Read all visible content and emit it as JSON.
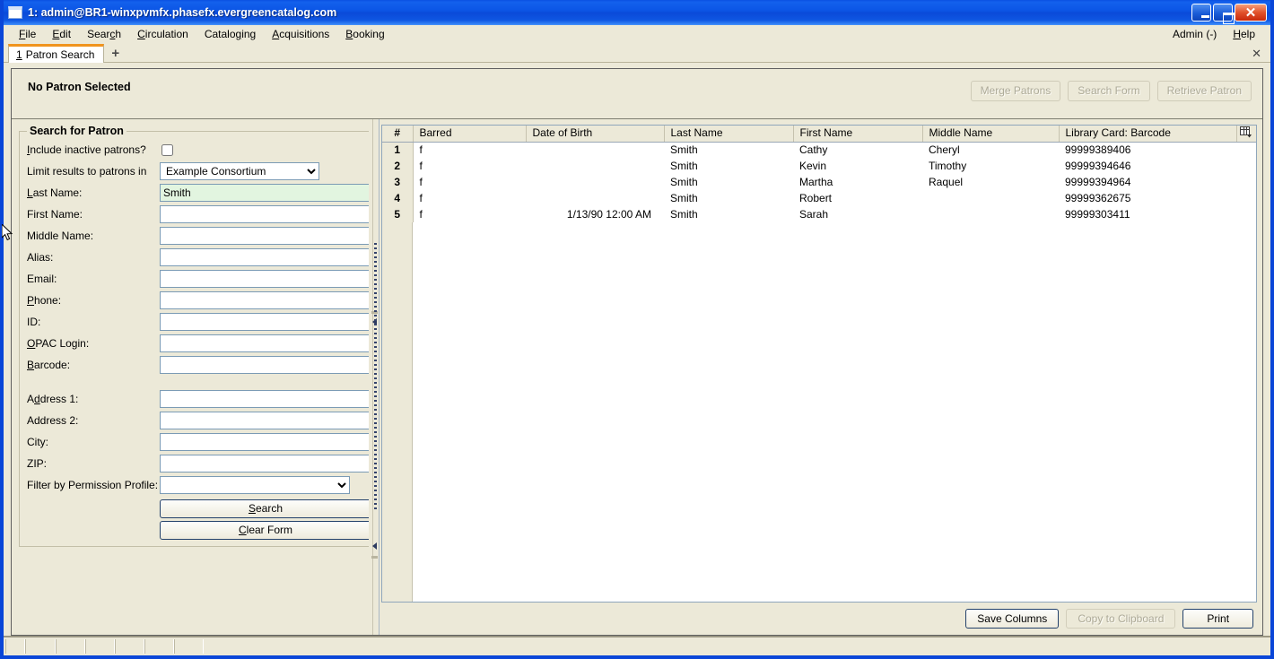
{
  "window": {
    "title": "1: admin@BR1-winxpvmfx.phasefx.evergreencatalog.com",
    "minimize_label": "",
    "maximize_label": "",
    "close_label": "✕"
  },
  "menubar": {
    "items": [
      {
        "label": "File",
        "mnemonic": "F"
      },
      {
        "label": "Edit",
        "mnemonic": "E"
      },
      {
        "label": "Search",
        "mnemonic": "c"
      },
      {
        "label": "Circulation",
        "mnemonic": "C"
      },
      {
        "label": "Cataloging",
        "mnemonic": "g"
      },
      {
        "label": "Acquisitions",
        "mnemonic": "A"
      },
      {
        "label": "Booking",
        "mnemonic": "B"
      }
    ],
    "right_items": [
      {
        "label": "Admin (-)"
      },
      {
        "label": "Help",
        "mnemonic": "H"
      }
    ]
  },
  "tabstrip": {
    "tabs": [
      {
        "number": "1",
        "label": "Patron Search"
      }
    ],
    "new_tab_label": "+",
    "close_label": "✕"
  },
  "patron_bar": {
    "status": "No Patron Selected",
    "actions": [
      {
        "label": "Merge Patrons",
        "disabled": true
      },
      {
        "label": "Search Form",
        "disabled": true
      },
      {
        "label": "Retrieve Patron",
        "disabled": true
      }
    ]
  },
  "search_form": {
    "legend": "Search for Patron",
    "include_inactive_label": "Include inactive patrons?",
    "include_inactive_checked": false,
    "limit_label": "Limit results to patrons in",
    "limit_value": "Example Consortium",
    "limit_options": [
      "Example Consortium"
    ],
    "fields": [
      {
        "label": "Last Name:",
        "value": "Smith",
        "focused": true
      },
      {
        "label": "First Name:",
        "value": ""
      },
      {
        "label": "Middle Name:",
        "value": ""
      },
      {
        "label": "Alias:",
        "value": ""
      },
      {
        "label": "Email:",
        "value": ""
      },
      {
        "label": "Phone:",
        "value": ""
      },
      {
        "label": "ID:",
        "value": ""
      },
      {
        "label": "OPAC Login:",
        "value": ""
      },
      {
        "label": "Barcode:",
        "value": ""
      }
    ],
    "address_fields": [
      {
        "label": "Address 1:",
        "value": ""
      },
      {
        "label": "Address 2:",
        "value": ""
      },
      {
        "label": "City:",
        "value": ""
      },
      {
        "label": "ZIP:",
        "value": ""
      }
    ],
    "permission_label": "Filter by Permission Profile:",
    "permission_value": "",
    "permission_options": [
      ""
    ],
    "search_button": "Search",
    "clear_button": "Clear Form"
  },
  "results": {
    "columns": [
      "#",
      "Barred",
      "Date of Birth",
      "Last Name",
      "First Name",
      "Middle Name",
      "Library Card: Barcode"
    ],
    "column_picker_icon": "column-picker-icon",
    "rows": [
      {
        "num": "1",
        "barred": "f",
        "dob": "",
        "last": "Smith",
        "first": "Cathy",
        "middle": "Cheryl",
        "barcode": "99999389406"
      },
      {
        "num": "2",
        "barred": "f",
        "dob": "",
        "last": "Smith",
        "first": "Kevin",
        "middle": "Timothy",
        "barcode": "99999394646"
      },
      {
        "num": "3",
        "barred": "f",
        "dob": "",
        "last": "Smith",
        "first": "Martha",
        "middle": "Raquel",
        "barcode": "99999394964"
      },
      {
        "num": "4",
        "barred": "f",
        "dob": "",
        "last": "Smith",
        "first": "Robert",
        "middle": "",
        "barcode": "99999362675"
      },
      {
        "num": "5",
        "barred": "f",
        "dob": "1/13/90 12:00 AM",
        "last": "Smith",
        "first": "Sarah",
        "middle": "",
        "barcode": "99999303411"
      }
    ],
    "footer_buttons": [
      {
        "label": "Save Columns",
        "disabled": false
      },
      {
        "label": "Copy to Clipboard",
        "disabled": true
      },
      {
        "label": "Print",
        "disabled": false
      }
    ]
  },
  "statusbar": {
    "segments": [
      "",
      "",
      "",
      "",
      "",
      "",
      "",
      ""
    ]
  },
  "colors": {
    "titlebar_blue": "#0a46d8",
    "chrome_beige": "#ece9d8",
    "tab_accent_orange": "#f0941e",
    "field_focus_green": "#e2f5e0",
    "field_border": "#7b9bb5"
  }
}
